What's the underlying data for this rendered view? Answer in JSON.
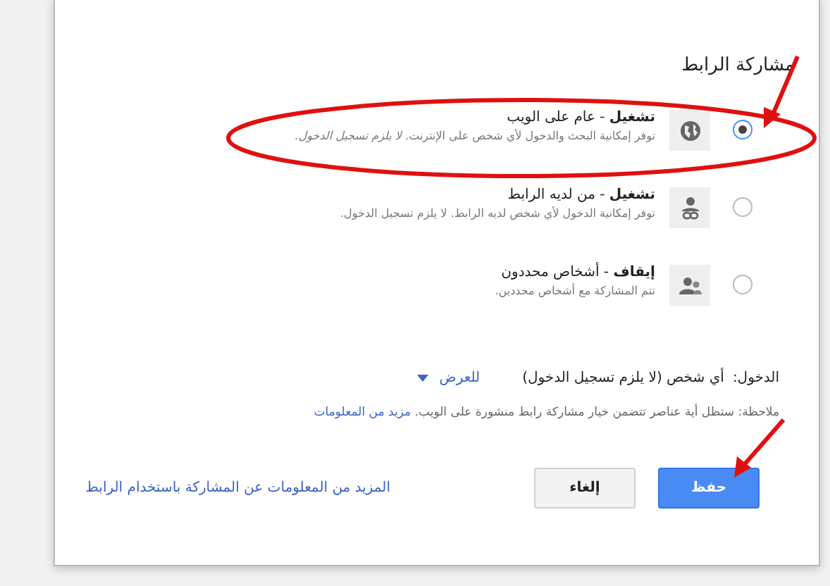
{
  "dialog": {
    "title": "مشاركة الرابط",
    "options": [
      {
        "kind": "public",
        "label": "**تشغيل** - عام على الويب",
        "description": "توفر إمكانية البحث والدخول لأي شخص على الإنترنت. *لا يلزم تسجيل الدخول.*",
        "selected": true
      },
      {
        "kind": "link",
        "label": "**تشغيل** - من لديه الرابط",
        "description": "توفر إمكانية الدخول لأي شخص لديه الرابط. لا يلزم تسجيل الدخول.",
        "selected": false
      },
      {
        "kind": "private",
        "label": "**إيقاف** - أشخاص محددون",
        "description": "تتم المشاركة مع أشخاص محددين.",
        "selected": false
      }
    ],
    "access": {
      "label": "الدخول:",
      "value": "أي شخص (لا يلزم تسجيل الدخول)",
      "permission": "للعرض"
    },
    "note": {
      "text": "ملاحظة: ستظل أية عناصر تتضمن خيار مشاركة رابط منشورة على الويب.",
      "link": "مزيد من المعلومات"
    },
    "buttons": [
      {
        "kind": "primary",
        "label": "حفظ"
      },
      {
        "kind": "secondary",
        "label": "إلغاء"
      }
    ],
    "help_link": "المزيد من المعلومات عن المشاركة باستخدام الرابط"
  }
}
